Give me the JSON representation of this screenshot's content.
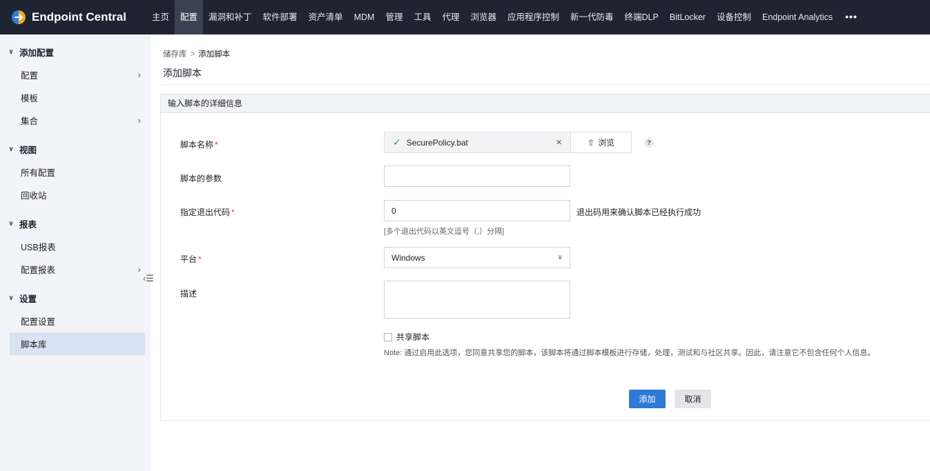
{
  "brand": {
    "name": "Endpoint Central",
    "logo_icon": "endpoint-central-logo",
    "accent": "#f3a623"
  },
  "nav": {
    "items": [
      "主页",
      "配置",
      "漏洞和补丁",
      "软件部署",
      "资产清单",
      "MDM",
      "管理",
      "工具",
      "代理",
      "浏览器",
      "应用程序控制",
      "新一代防毒",
      "终端DLP",
      "BitLocker",
      "设备控制",
      "Endpoint Analytics"
    ],
    "active": "配置",
    "more": "•••"
  },
  "sidebar": {
    "groups": [
      {
        "title": "添加配置",
        "items": [
          {
            "label": "配置",
            "has_submenu": true
          },
          {
            "label": "模板",
            "has_submenu": false
          },
          {
            "label": "集合",
            "has_submenu": true
          }
        ]
      },
      {
        "title": "视图",
        "items": [
          {
            "label": "所有配置",
            "has_submenu": false
          },
          {
            "label": "回收站",
            "has_submenu": false
          }
        ]
      },
      {
        "title": "报表",
        "items": [
          {
            "label": "USB报表",
            "has_submenu": false
          },
          {
            "label": "配置报表",
            "has_submenu": true
          }
        ]
      },
      {
        "title": "设置",
        "items": [
          {
            "label": "配置设置",
            "has_submenu": false
          },
          {
            "label": "脚本库",
            "has_submenu": false
          }
        ]
      }
    ],
    "selected": "脚本库"
  },
  "breadcrumb": {
    "parent": "储存库",
    "separator": ">",
    "current": "添加脚本"
  },
  "page_title": "添加脚本",
  "form": {
    "section_title": "输入脚本的详细信息",
    "script_name": {
      "label": "脚本名称",
      "required_mark": "*",
      "file": "SecurePolicy.bat",
      "browse_label": "浏览",
      "help": "?"
    },
    "params": {
      "label": "脚本的参数",
      "value": ""
    },
    "exit_code": {
      "label": "指定退出代码",
      "required_mark": "*",
      "value": "0",
      "hint_right": "退出码用来确认脚本已经执行成功",
      "hint_below": "[多个退出代码以英文逗号（,）分隔]"
    },
    "platform": {
      "label": "平台",
      "required_mark": "*",
      "value": "Windows"
    },
    "description": {
      "label": "描述",
      "value": ""
    },
    "share": {
      "label": "共享脚本",
      "checked": false,
      "note": "Note: 通过启用此选项，您同意共享您的脚本，该脚本将通过脚本模板进行存储，处理，测试和与社区共享。因此，请注意它不包含任何个人信息。"
    },
    "buttons": {
      "add": "添加",
      "cancel": "取消"
    }
  },
  "colors": {
    "topbar": "#1e2431",
    "sidebar": "#f3f4f7",
    "selected": "#d8e3f3",
    "primary": "#2f79d6",
    "success": "#2e9a4d",
    "required": "#e0393e"
  }
}
